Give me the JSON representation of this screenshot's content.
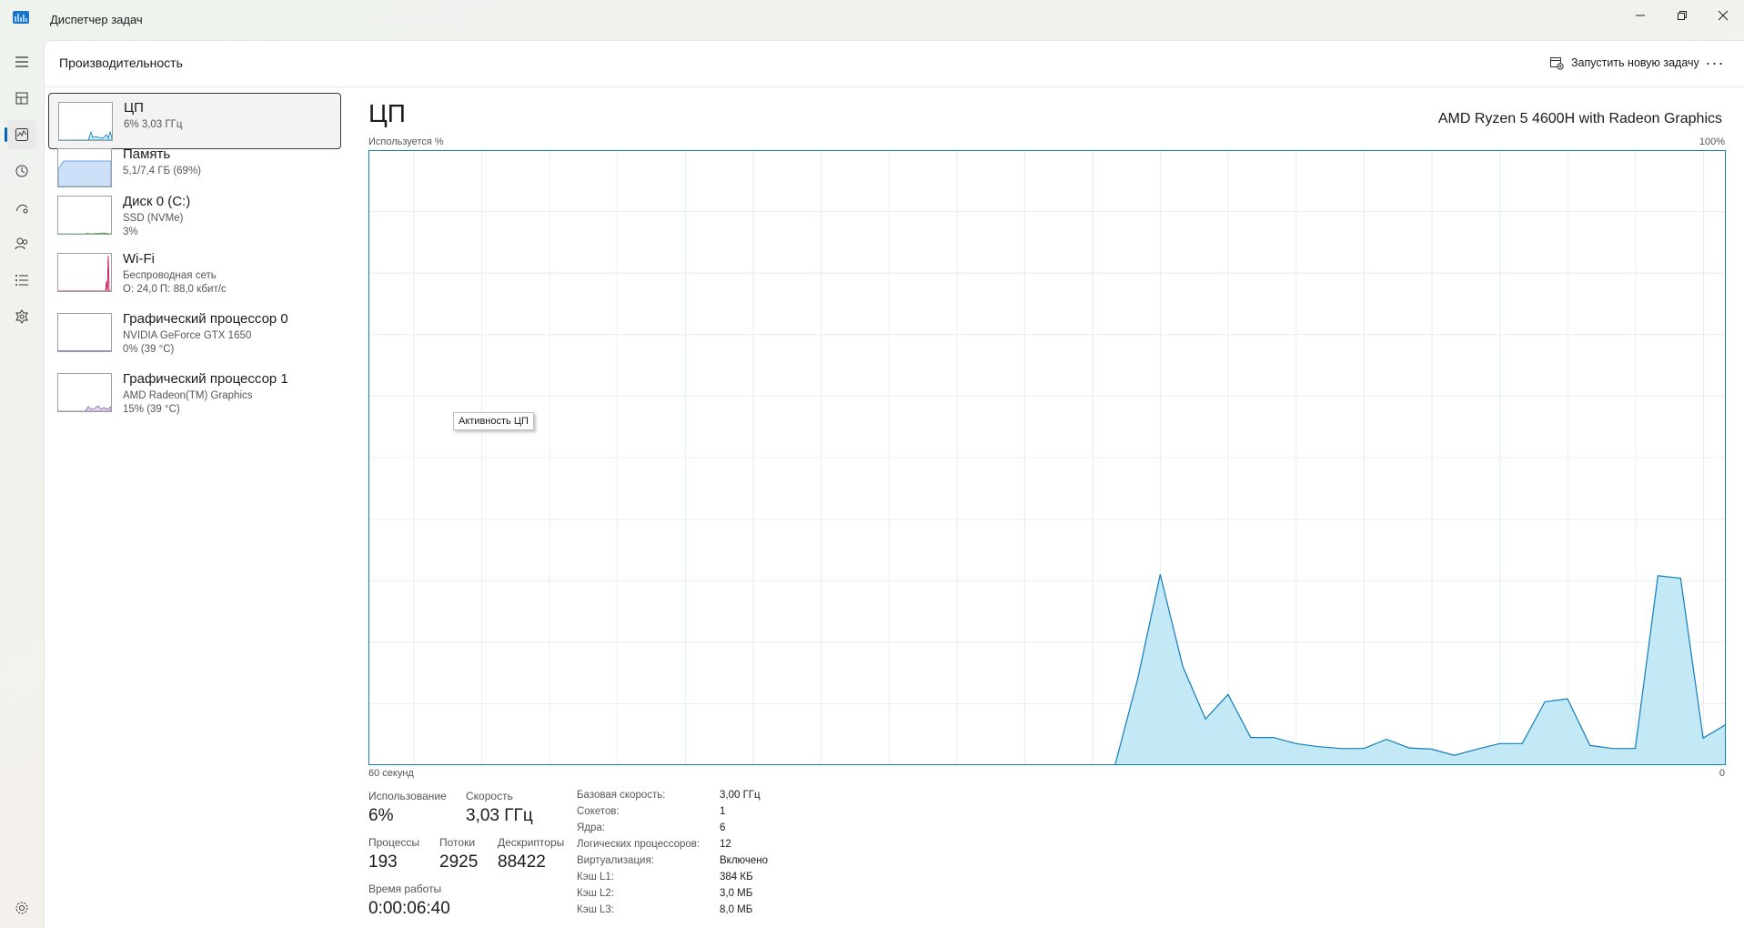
{
  "window": {
    "title": "Диспетчер задач"
  },
  "header": {
    "title": "Производительность",
    "run_task": "Запустить новую задачу",
    "more": "···"
  },
  "nav": [
    "hamburger-icon",
    "processes-icon",
    "performance-icon",
    "app-history-icon",
    "startup-apps-icon",
    "users-icon",
    "details-icon",
    "services-icon",
    "settings-icon"
  ],
  "devices": [
    {
      "name": "ЦП",
      "line2": "6% 3,03 ГГц",
      "line3": "",
      "color": "#1f8ad2"
    },
    {
      "name": "Память",
      "line2": "5,1/7,4 ГБ (69%)",
      "line3": "",
      "color": "#4a90e2"
    },
    {
      "name": "Диск 0 (C:)",
      "line2": "SSD (NVMe)",
      "line3": "3%",
      "color": "#4caf50"
    },
    {
      "name": "Wi-Fi",
      "line2": "Беспроводная сеть",
      "line3": "О: 24,0 П: 88,0 кбит/с",
      "color": "#c2185b"
    },
    {
      "name": "Графический процессор 0",
      "line2": "NVIDIA GeForce GTX 1650",
      "line3": "0% (39 °C)",
      "color": "#7b5ea7"
    },
    {
      "name": "Графический процессор 1",
      "line2": "AMD Radeon(TM) Graphics",
      "line3": "15% (39 °C)",
      "color": "#7b5ea7"
    }
  ],
  "cpu": {
    "title": "ЦП",
    "model": "AMD Ryzen 5 4600H with Radeon Graphics",
    "y_label": "Используется %",
    "y_max_label": "100%",
    "x_left_label": "60 секунд",
    "x_right_label": "0",
    "tooltip": "Активность ЦП"
  },
  "chart_data": {
    "type": "area",
    "x": [
      60,
      59,
      58,
      57,
      56,
      55,
      54,
      53,
      52,
      51,
      50,
      49,
      48,
      47,
      46,
      45,
      44,
      43,
      42,
      41,
      40,
      39,
      38,
      37,
      36,
      35,
      34,
      33,
      32,
      31,
      30,
      29,
      28,
      27,
      26,
      25,
      24,
      23,
      22,
      21,
      20,
      19,
      18,
      17,
      16,
      15,
      14,
      13,
      12,
      11,
      10,
      9,
      8,
      7,
      6,
      5,
      4,
      3,
      2,
      1,
      0
    ],
    "values": [
      0,
      0,
      0,
      0,
      0,
      0,
      0,
      0,
      0,
      0,
      0,
      0,
      0,
      0,
      0,
      0,
      0,
      0,
      0,
      0,
      0,
      0,
      0,
      0,
      0,
      0,
      0,
      0,
      0,
      0,
      0,
      0,
      0,
      0,
      14,
      31,
      16,
      7.5,
      11.5,
      4.5,
      4.5,
      3.5,
      3,
      2.7,
      2.7,
      4.2,
      2.8,
      2.6,
      1.6,
      2.6,
      3.5,
      3.5,
      10.3,
      10.8,
      3.2,
      2.7,
      2.7,
      30.8,
      30.4,
      4.4,
      6.6
    ],
    "ylim": [
      0,
      100
    ],
    "grid": true,
    "color": "#117dbb",
    "fill": "#c3e8f6"
  },
  "stats": {
    "usage": {
      "label": "Использование",
      "value": "6%"
    },
    "speed": {
      "label": "Скорость",
      "value": "3,03 ГГц"
    },
    "processes": {
      "label": "Процессы",
      "value": "193"
    },
    "threads": {
      "label": "Потоки",
      "value": "2925"
    },
    "handles": {
      "label": "Дескрипторы",
      "value": "88422"
    },
    "uptime": {
      "label": "Время работы",
      "value": "0:00:06:40"
    }
  },
  "specs": [
    {
      "k": "Базовая скорость:",
      "v": "3,00 ГГц"
    },
    {
      "k": "Сокетов:",
      "v": "1"
    },
    {
      "k": "Ядра:",
      "v": "6"
    },
    {
      "k": "Логических процессоров:",
      "v": "12"
    },
    {
      "k": "Виртуализация:",
      "v": "Включено"
    },
    {
      "k": "Кэш L1:",
      "v": "384 КБ"
    },
    {
      "k": "Кэш L2:",
      "v": "3,0 МБ"
    },
    {
      "k": "Кэш L3:",
      "v": "8,0 МБ"
    }
  ]
}
